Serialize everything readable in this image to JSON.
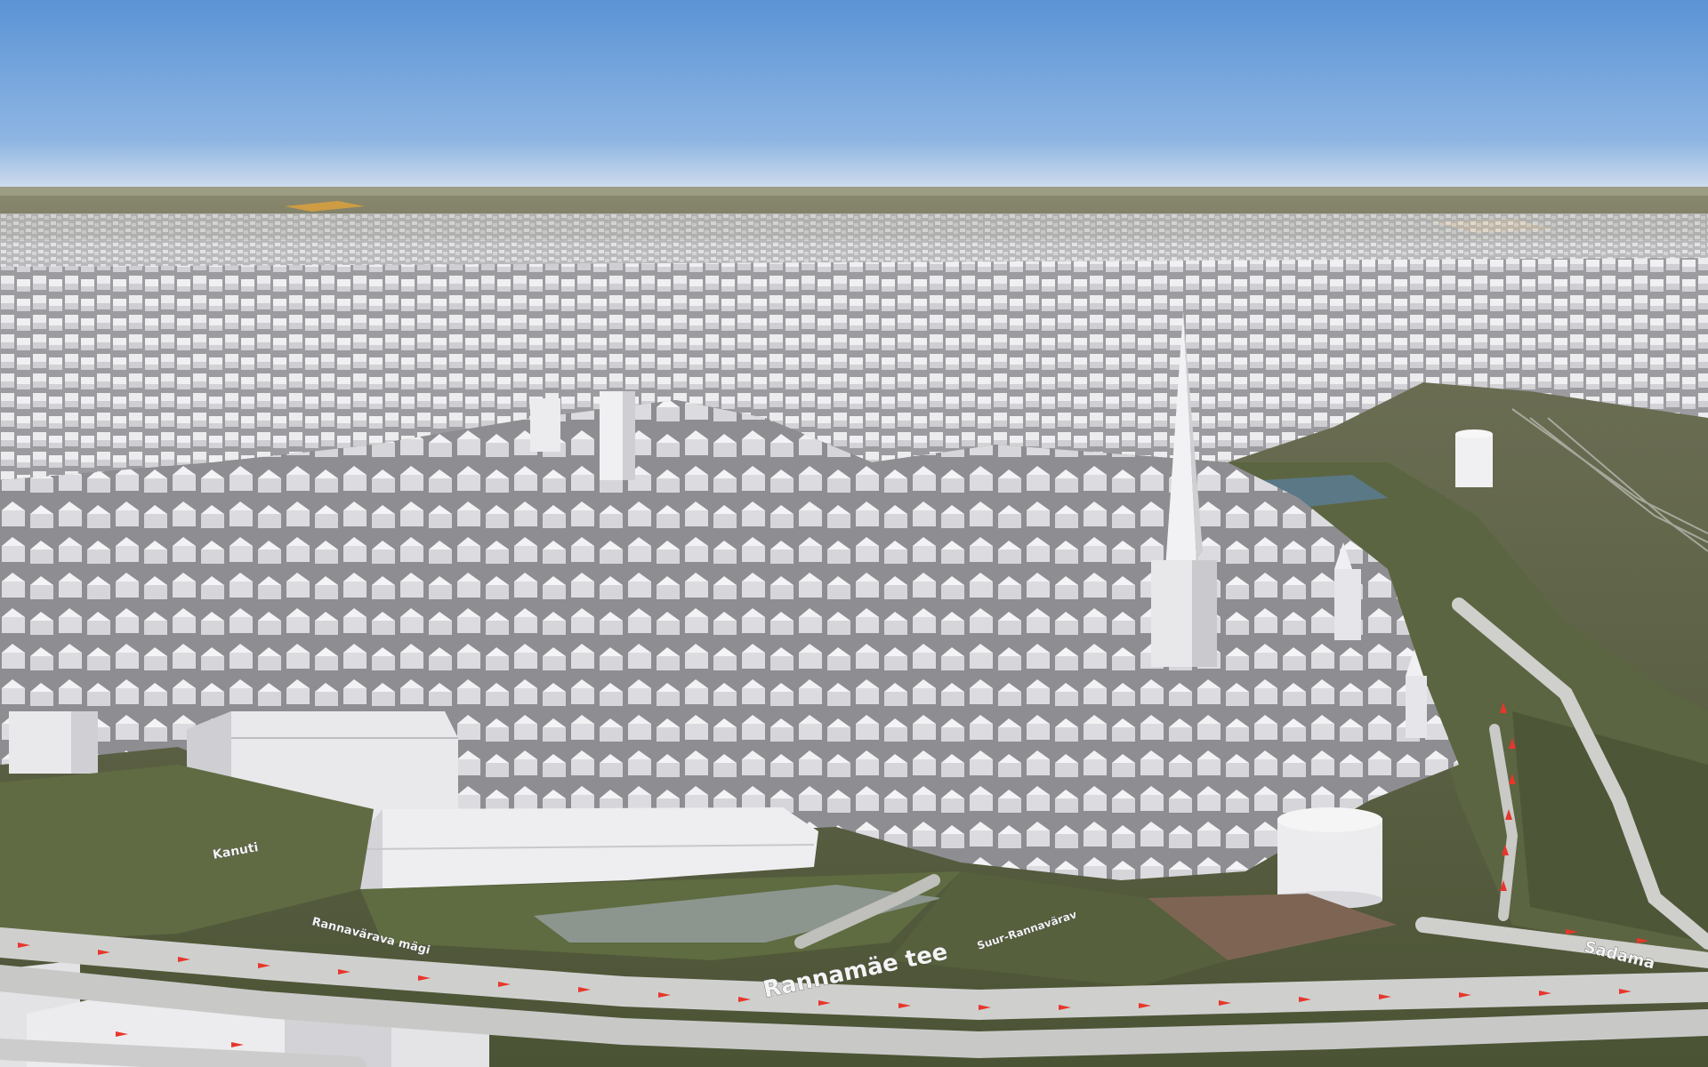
{
  "map": {
    "view": "3d-city-buildings",
    "colors": {
      "sky_top": "#5c95d6",
      "sky_horizon": "#c8d9ee",
      "building": "#e6e6e9",
      "building_shade": "#c7c7cc",
      "grass": "#56603f",
      "road": "#d8d8d8",
      "route_marker": "#e8362c"
    },
    "street_labels": [
      {
        "id": "rannamae-tee",
        "text": "Rannamäe tee"
      },
      {
        "id": "kanuti",
        "text": "Kanuti"
      },
      {
        "id": "rannavarava-mage",
        "text": "Rannavärava mägi"
      },
      {
        "id": "suur-rannavarav",
        "text": "Suur-Rannavärav"
      },
      {
        "id": "pikk-side",
        "text": "Sadama"
      }
    ]
  }
}
